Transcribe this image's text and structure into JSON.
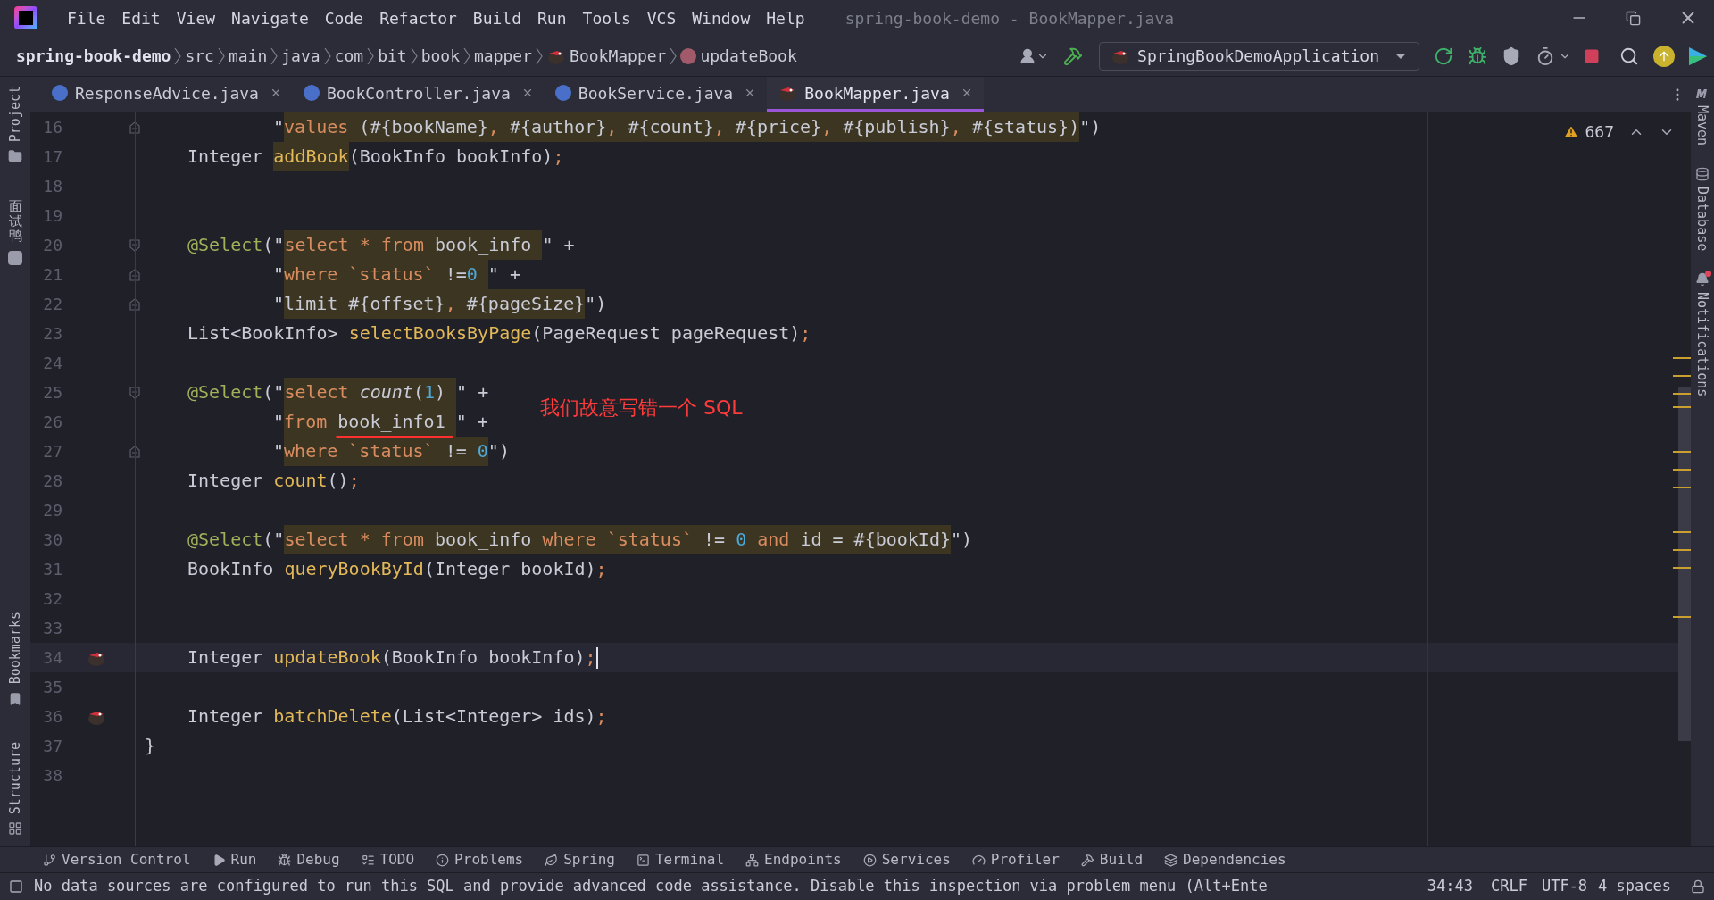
{
  "window": {
    "title": "spring-book-demo - BookMapper.java"
  },
  "menu": [
    "File",
    "Edit",
    "View",
    "Navigate",
    "Code",
    "Refactor",
    "Build",
    "Run",
    "Tools",
    "VCS",
    "Window",
    "Help"
  ],
  "breadcrumbs": [
    {
      "label": "spring-book-demo",
      "kind": "project"
    },
    {
      "label": "src",
      "kind": "folder"
    },
    {
      "label": "main",
      "kind": "folder"
    },
    {
      "label": "java",
      "kind": "folder"
    },
    {
      "label": "com",
      "kind": "folder"
    },
    {
      "label": "bit",
      "kind": "folder"
    },
    {
      "label": "book",
      "kind": "folder"
    },
    {
      "label": "mapper",
      "kind": "folder"
    },
    {
      "label": "BookMapper",
      "kind": "mapper"
    },
    {
      "label": "updateBook",
      "kind": "method"
    }
  ],
  "run_config": "SpringBookDemoApplication",
  "tabs": [
    {
      "label": "ResponseAdvice.java",
      "kind": "class",
      "selected": false
    },
    {
      "label": "BookController.java",
      "kind": "class",
      "selected": false
    },
    {
      "label": "BookService.java",
      "kind": "class",
      "selected": false
    },
    {
      "label": "BookMapper.java",
      "kind": "mapper",
      "selected": true
    }
  ],
  "left_tools": [
    {
      "label": "Project",
      "kind": "folder"
    },
    {
      "label": "面试鸭",
      "kind": "cjk"
    },
    {
      "label": "Bookmarks",
      "kind": "bookmark"
    },
    {
      "label": "Structure",
      "kind": "structure"
    }
  ],
  "right_tools": [
    {
      "label": "Maven",
      "kind": "maven"
    },
    {
      "label": "Database",
      "kind": "database"
    },
    {
      "label": "Notifications",
      "kind": "bell"
    }
  ],
  "inspection": {
    "warnings": "667"
  },
  "annotation": {
    "text": "我们故意写错一个 SQL"
  },
  "editor": {
    "lines": [
      {
        "number": "16",
        "current": false,
        "gutter_mark": false,
        "kind": "continuation",
        "fold": {
          "kind": "end"
        },
        "tokens": [
          {
            "kind": "p",
            "text": "\"",
            "sql": false
          },
          {
            "kind": "kw",
            "text": "values",
            "sql": true
          },
          {
            "kind": "p",
            "text": " (#{bookName}",
            "sql": true
          },
          {
            "kind": "kw",
            "text": ", ",
            "sql": true
          },
          {
            "kind": "p",
            "text": "#{author}",
            "sql": true
          },
          {
            "kind": "kw",
            "text": ", ",
            "sql": true
          },
          {
            "kind": "p",
            "text": "#{count}",
            "sql": true
          },
          {
            "kind": "kw",
            "text": ", ",
            "sql": true
          },
          {
            "kind": "p",
            "text": "#{price}",
            "sql": true
          },
          {
            "kind": "kw",
            "text": ", ",
            "sql": true
          },
          {
            "kind": "p",
            "text": "#{publish}",
            "sql": true
          },
          {
            "kind": "kw",
            "text": ", ",
            "sql": true
          },
          {
            "kind": "p",
            "text": "#{status})",
            "sql": true
          },
          {
            "kind": "p",
            "text": "\")",
            "sql": false
          }
        ]
      },
      {
        "number": "17",
        "current": false,
        "gutter_mark": false,
        "kind": "member",
        "tokens": [
          {
            "kind": "p",
            "text": "Integer ",
            "sql": false
          },
          {
            "kind": "fn",
            "text": "addBook",
            "sql": true
          },
          {
            "kind": "p",
            "text": "(BookInfo bookInfo)",
            "sql": false
          },
          {
            "kind": "kw",
            "text": ";",
            "sql": false
          }
        ]
      },
      {
        "number": "18",
        "current": false,
        "gutter_mark": false
      },
      {
        "number": "19",
        "current": false,
        "gutter_mark": false
      },
      {
        "number": "20",
        "current": false,
        "gutter_mark": false,
        "kind": "member",
        "fold": {
          "kind": "start"
        },
        "tokens": [
          {
            "kind": "ann",
            "text": "@Select",
            "sql": false
          },
          {
            "kind": "p",
            "text": "(\"",
            "sql": false
          },
          {
            "kind": "kw",
            "text": "select * from",
            "sql": true
          },
          {
            "kind": "p",
            "text": " book_info ",
            "sql": true
          },
          {
            "kind": "p",
            "text": "\" +",
            "sql": false
          }
        ]
      },
      {
        "number": "21",
        "current": false,
        "gutter_mark": false,
        "kind": "continuation",
        "fold": {
          "kind": "end"
        },
        "tokens": [
          {
            "kind": "p",
            "text": "\"",
            "sql": false
          },
          {
            "kind": "kw",
            "text": "where `status`",
            "sql": true
          },
          {
            "kind": "p",
            "text": " !=",
            "sql": true
          },
          {
            "kind": "num",
            "text": "0 ",
            "sql": true
          },
          {
            "kind": "p",
            "text": "\" +",
            "sql": false
          }
        ]
      },
      {
        "number": "22",
        "current": false,
        "gutter_mark": false,
        "kind": "continuation",
        "fold": {
          "kind": "end"
        },
        "tokens": [
          {
            "kind": "p",
            "text": "\"",
            "sql": false
          },
          {
            "kind": "p",
            "text": "limit #{offset}",
            "sql": true
          },
          {
            "kind": "kw",
            "text": ", ",
            "sql": true
          },
          {
            "kind": "p",
            "text": "#{pageSize}",
            "sql": true
          },
          {
            "kind": "p",
            "text": "\")",
            "sql": false
          }
        ]
      },
      {
        "number": "23",
        "current": false,
        "gutter_mark": false,
        "kind": "member",
        "tokens": [
          {
            "kind": "p",
            "text": "List<BookInfo> ",
            "sql": false
          },
          {
            "kind": "fn",
            "text": "selectBooksByPage",
            "sql": false
          },
          {
            "kind": "p",
            "text": "(PageRequest pageRequest)",
            "sql": false
          },
          {
            "kind": "kw",
            "text": ";",
            "sql": false
          }
        ]
      },
      {
        "number": "24",
        "current": false,
        "gutter_mark": false
      },
      {
        "number": "25",
        "current": false,
        "gutter_mark": false,
        "kind": "member",
        "fold": {
          "kind": "start"
        },
        "tokens": [
          {
            "kind": "ann",
            "text": "@Select",
            "sql": false
          },
          {
            "kind": "p",
            "text": "(\"",
            "sql": false
          },
          {
            "kind": "kw",
            "text": "select ",
            "sql": true
          },
          {
            "kind": "it",
            "text": "count",
            "sql": true
          },
          {
            "kind": "p",
            "text": "(",
            "sql": true
          },
          {
            "kind": "num",
            "text": "1",
            "sql": true
          },
          {
            "kind": "p",
            "text": ") ",
            "sql": true
          },
          {
            "kind": "p",
            "text": "\" +",
            "sql": false
          }
        ]
      },
      {
        "number": "26",
        "current": false,
        "gutter_mark": false,
        "kind": "continuation",
        "tokens": [
          {
            "kind": "p",
            "text": "\"",
            "sql": false
          },
          {
            "kind": "kw",
            "text": "from ",
            "sql": true
          },
          {
            "kind": "p",
            "text": "book_info1 ",
            "sql": true
          },
          {
            "kind": "p",
            "text": "\" +",
            "sql": false
          }
        ]
      },
      {
        "number": "27",
        "current": false,
        "gutter_mark": false,
        "kind": "continuation",
        "fold": {
          "kind": "end"
        },
        "tokens": [
          {
            "kind": "p",
            "text": "\"",
            "sql": false
          },
          {
            "kind": "kw",
            "text": "where `status`",
            "sql": true
          },
          {
            "kind": "p",
            "text": " != ",
            "sql": true
          },
          {
            "kind": "num",
            "text": "0",
            "sql": true
          },
          {
            "kind": "p",
            "text": "\")",
            "sql": false
          }
        ]
      },
      {
        "number": "28",
        "current": false,
        "gutter_mark": false,
        "kind": "member",
        "tokens": [
          {
            "kind": "p",
            "text": "Integer ",
            "sql": false
          },
          {
            "kind": "fn",
            "text": "count",
            "sql": false
          },
          {
            "kind": "p",
            "text": "()",
            "sql": false
          },
          {
            "kind": "kw",
            "text": ";",
            "sql": false
          }
        ]
      },
      {
        "number": "29",
        "current": false,
        "gutter_mark": false
      },
      {
        "number": "30",
        "current": false,
        "gutter_mark": false,
        "kind": "member",
        "tokens": [
          {
            "kind": "ann",
            "text": "@Select",
            "sql": false
          },
          {
            "kind": "p",
            "text": "(\"",
            "sql": false
          },
          {
            "kind": "kw",
            "text": "select * from",
            "sql": true
          },
          {
            "kind": "p",
            "text": " book_info ",
            "sql": true
          },
          {
            "kind": "kw",
            "text": "where `status`",
            "sql": true
          },
          {
            "kind": "p",
            "text": " != ",
            "sql": true
          },
          {
            "kind": "num",
            "text": "0 ",
            "sql": true
          },
          {
            "kind": "kw",
            "text": "and",
            "sql": true
          },
          {
            "kind": "p",
            "text": " id = #{bookId}",
            "sql": true
          },
          {
            "kind": "p",
            "text": "\")",
            "sql": false
          }
        ]
      },
      {
        "number": "31",
        "current": false,
        "gutter_mark": false,
        "kind": "member",
        "tokens": [
          {
            "kind": "p",
            "text": "BookInfo ",
            "sql": false
          },
          {
            "kind": "fn",
            "text": "queryBookById",
            "sql": false
          },
          {
            "kind": "p",
            "text": "(Integer bookId)",
            "sql": false
          },
          {
            "kind": "kw",
            "text": ";",
            "sql": false
          }
        ]
      },
      {
        "number": "32",
        "current": false,
        "gutter_mark": false
      },
      {
        "number": "33",
        "current": false,
        "gutter_mark": false
      },
      {
        "number": "34",
        "current": true,
        "gutter_mark": true,
        "kind": "member",
        "tokens": [
          {
            "kind": "p",
            "text": "Integer ",
            "sql": false
          },
          {
            "kind": "fn",
            "text": "updateBook",
            "sql": false
          },
          {
            "kind": "p",
            "text": "(BookInfo bookInfo)",
            "sql": false
          },
          {
            "kind": "kw",
            "text": ";",
            "sql": false
          }
        ]
      },
      {
        "number": "35",
        "current": false,
        "gutter_mark": false
      },
      {
        "number": "36",
        "current": false,
        "gutter_mark": true,
        "kind": "member",
        "tokens": [
          {
            "kind": "p",
            "text": "Integer ",
            "sql": false
          },
          {
            "kind": "fn",
            "text": "batchDelete",
            "sql": false
          },
          {
            "kind": "p",
            "text": "(List<Integer> ids)",
            "sql": false
          },
          {
            "kind": "kw",
            "text": ";",
            "sql": false
          }
        ]
      },
      {
        "number": "37",
        "current": false,
        "gutter_mark": false,
        "kind": "top",
        "tokens": [
          {
            "kind": "p",
            "text": "}",
            "sql": false
          }
        ]
      },
      {
        "number": "38",
        "current": false,
        "gutter_mark": false
      }
    ]
  },
  "tool_windows": [
    {
      "label": "Version Control",
      "kind": "vcs"
    },
    {
      "label": "Run",
      "kind": "run"
    },
    {
      "label": "Debug",
      "kind": "debug"
    },
    {
      "label": "TODO",
      "kind": "todo"
    },
    {
      "label": "Problems",
      "kind": "problems"
    },
    {
      "label": "Spring",
      "kind": "spring"
    },
    {
      "label": "Terminal",
      "kind": "terminal"
    },
    {
      "label": "Endpoints",
      "kind": "endpoints"
    },
    {
      "label": "Services",
      "kind": "services"
    },
    {
      "label": "Profiler",
      "kind": "profiler"
    },
    {
      "label": "Build",
      "kind": "build"
    },
    {
      "label": "Dependencies",
      "kind": "dependencies"
    }
  ],
  "status_bar": {
    "message": "No data sources are configured to run this SQL and provide advanced code assistance. Disable this inspection via problem menu (Alt+Ente",
    "position": "34:43",
    "line_separator": "CRLF",
    "encoding": "UTF-8",
    "indent": "4 spaces"
  }
}
